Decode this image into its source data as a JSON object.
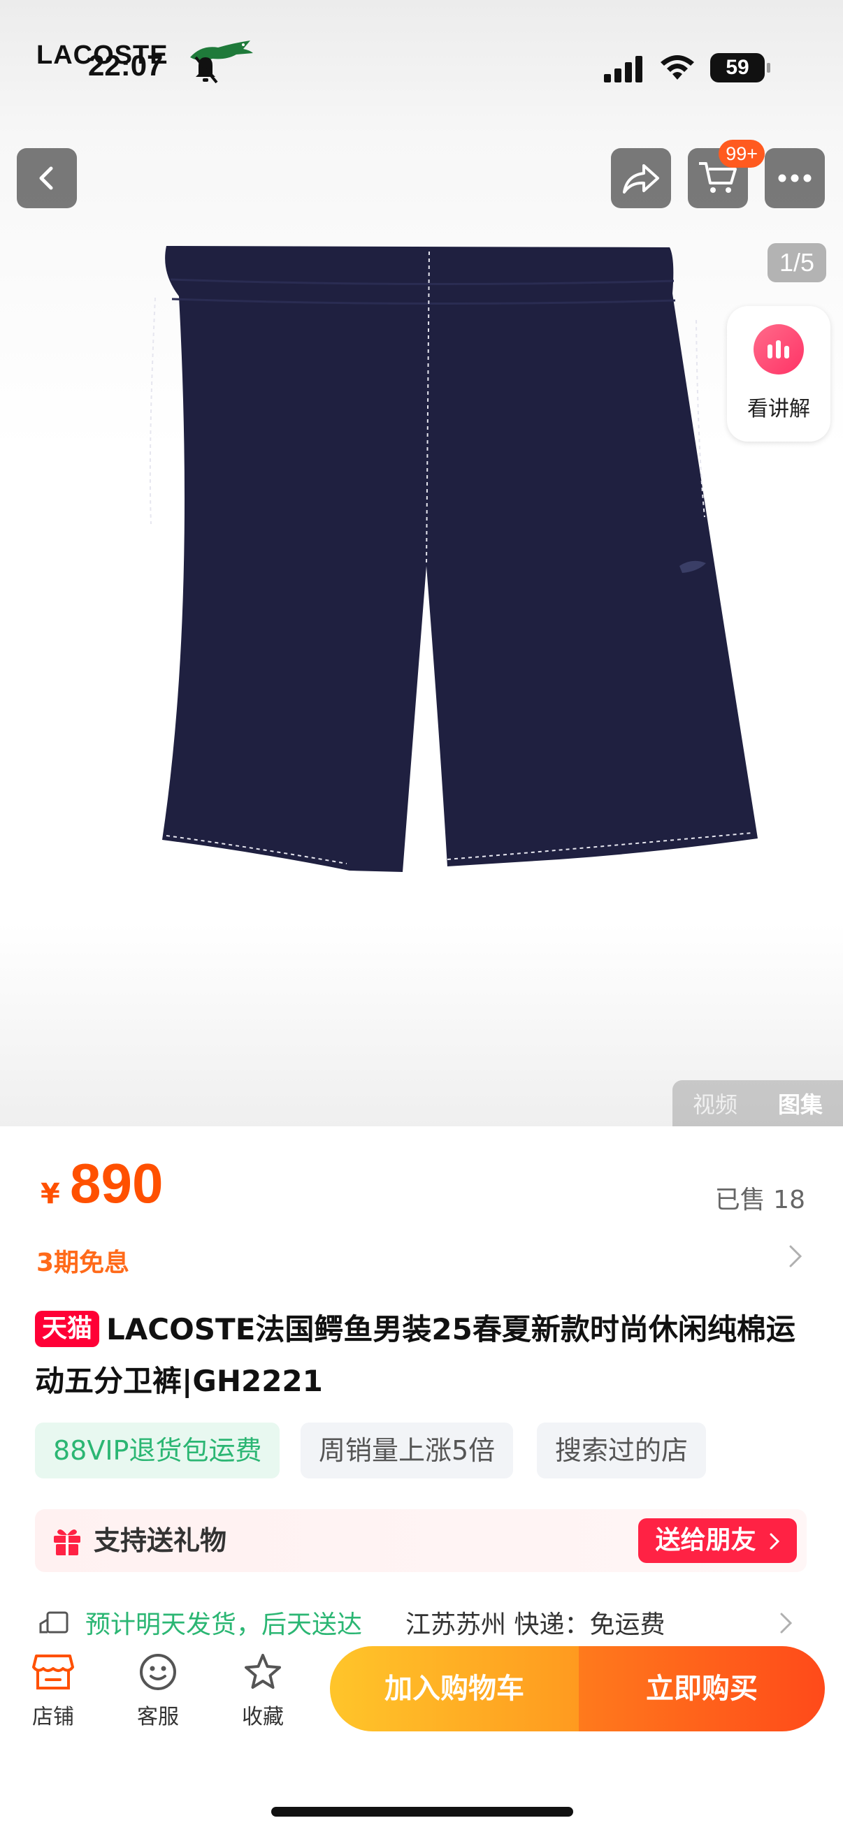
{
  "status_bar": {
    "brand_watermark": "LACOSTE",
    "time": "22:07",
    "battery": "59"
  },
  "gallery": {
    "page_counter": "1/5",
    "explain_label": "看讲解",
    "cart_badge": "99+",
    "tabs": [
      "视频",
      "图集"
    ],
    "active_tab": "图集"
  },
  "product": {
    "price_symbol": "¥",
    "price": "890",
    "sold": "已售 18",
    "installment": "3期免息",
    "platform_badge": "天猫",
    "title": "LACOSTE法国鳄鱼男装25春夏新款时尚休闲纯棉运动五分卫裤|GH2221",
    "tags": [
      "88VIP退货包运费",
      "周销量上涨5倍",
      "搜索过的店"
    ],
    "gift_label": "支持送礼物",
    "gift_button": "送给朋友",
    "delivery_green": "预计明天发货，后天送达",
    "delivery_info": "江苏苏州  快递：免运费"
  },
  "bottom_bar": {
    "store": "店铺",
    "service": "客服",
    "favorite": "收藏",
    "add_to_cart": "加入购物车",
    "buy_now": "立即购买"
  },
  "colors": {
    "accent_orange": "#ff5000",
    "tmall_red": "#ff0036",
    "green": "#2bb673",
    "product_navy": "#1f2040"
  }
}
